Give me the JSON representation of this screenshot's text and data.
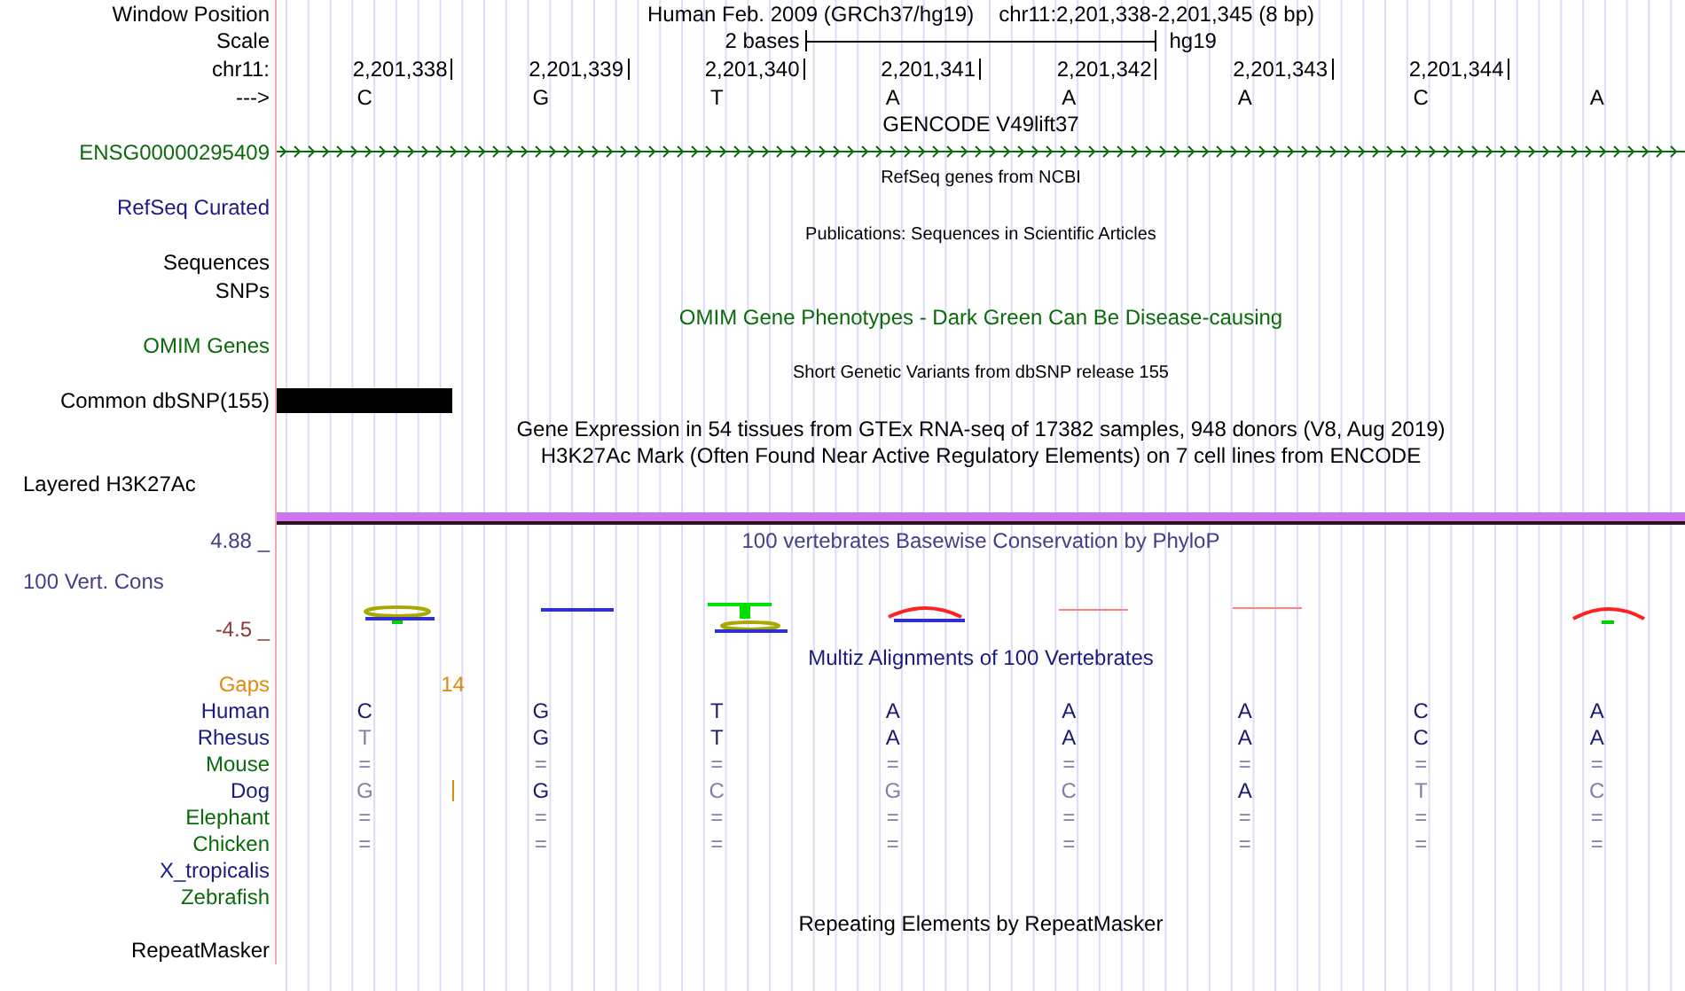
{
  "header": {
    "label": "Window Position",
    "assembly": "Human Feb. 2009 (GRCh37/hg19)",
    "position": "chr11:2,201,338-2,201,345 (8 bp)"
  },
  "scale": {
    "label": "Scale",
    "span": "2 bases",
    "database": "hg19"
  },
  "ruler": {
    "label": "chr11:",
    "positions": [
      "2,201,338",
      "2,201,339",
      "2,201,340",
      "2,201,341",
      "2,201,342",
      "2,201,343",
      "2,201,344"
    ]
  },
  "bases": {
    "label": "--->",
    "values": [
      "C",
      "G",
      "T",
      "A",
      "A",
      "A",
      "C",
      "A"
    ]
  },
  "tracks": [
    {
      "kind": "title",
      "title": "GENCODE V49lift37"
    },
    {
      "kind": "gene",
      "label": "ENSG00000295409",
      "color": "#0b6b0b"
    },
    {
      "kind": "small-title",
      "title": "RefSeq genes from NCBI"
    },
    {
      "kind": "label",
      "label": "RefSeq Curated",
      "color": "#1a1a80"
    },
    {
      "kind": "small-title",
      "title": "Publications: Sequences in Scientific Articles"
    },
    {
      "kind": "label",
      "label": "Sequences"
    },
    {
      "kind": "label",
      "label": "SNPs"
    },
    {
      "kind": "title",
      "title": "OMIM Gene Phenotypes - Dark Green Can Be Disease-causing",
      "color": "#0b6b0b"
    },
    {
      "kind": "label",
      "label": "OMIM Genes",
      "color": "#0b6b0b"
    },
    {
      "kind": "small-title",
      "title": "Short Genetic Variants from dbSNP release 155"
    },
    {
      "kind": "bar",
      "label": "Common dbSNP(155)"
    },
    {
      "kind": "title",
      "title": "Gene Expression in 54 tissues from GTEx RNA-seq of 17382 samples, 948 donors (V8, Aug 2019)"
    },
    {
      "kind": "title",
      "title": "H3K27Ac Mark (Often Found Near Active Regulatory Elements) on 7 cell lines from ENCODE"
    },
    {
      "kind": "left-label",
      "label": "Layered H3K27Ac"
    },
    {
      "kind": "divider"
    },
    {
      "kind": "wiggle",
      "max": "4.88 _",
      "title": "100 vertebrates Basewise Conservation by PhyloP",
      "label": "100 Vert. Cons",
      "min": "-4.5 _"
    },
    {
      "kind": "title",
      "title": "Multiz Alignments of 100 Vertebrates",
      "color": "#1a1a80"
    },
    {
      "kind": "gaps",
      "label": "Gaps",
      "count": "14"
    },
    {
      "kind": "species",
      "label": "Human",
      "color": "#1a1a80",
      "insertion": false,
      "bases": [
        {
          "text": "C",
          "match": true
        },
        {
          "text": "G",
          "match": true
        },
        {
          "text": "T",
          "match": true
        },
        {
          "text": "A",
          "match": true
        },
        {
          "text": "A",
          "match": true
        },
        {
          "text": "A",
          "match": true
        },
        {
          "text": "C",
          "match": true
        },
        {
          "text": "A",
          "match": true
        }
      ]
    },
    {
      "kind": "species",
      "label": "Rhesus",
      "color": "#1a1a80",
      "insertion": false,
      "bases": [
        {
          "text": "T",
          "match": false
        },
        {
          "text": "G",
          "match": true
        },
        {
          "text": "T",
          "match": true
        },
        {
          "text": "A",
          "match": true
        },
        {
          "text": "A",
          "match": true
        },
        {
          "text": "A",
          "match": true
        },
        {
          "text": "C",
          "match": true
        },
        {
          "text": "A",
          "match": true
        }
      ]
    },
    {
      "kind": "species",
      "label": "Mouse",
      "color": "#0b6b0b",
      "insertion": false,
      "bases": [
        {
          "text": "=",
          "match": false
        },
        {
          "text": "=",
          "match": false
        },
        {
          "text": "=",
          "match": false
        },
        {
          "text": "=",
          "match": false
        },
        {
          "text": "=",
          "match": false
        },
        {
          "text": "=",
          "match": false
        },
        {
          "text": "=",
          "match": false
        },
        {
          "text": "=",
          "match": false
        }
      ]
    },
    {
      "kind": "species",
      "label": "Dog",
      "color": "#1a1a80",
      "insertion": true,
      "bases": [
        {
          "text": "G",
          "match": false
        },
        {
          "text": "G",
          "match": true
        },
        {
          "text": "C",
          "match": false
        },
        {
          "text": "G",
          "match": false
        },
        {
          "text": "C",
          "match": false
        },
        {
          "text": "A",
          "match": true
        },
        {
          "text": "T",
          "match": false
        },
        {
          "text": "C",
          "match": false
        }
      ]
    },
    {
      "kind": "species",
      "label": "Elephant",
      "color": "#0b6b0b",
      "insertion": false,
      "bases": [
        {
          "text": "=",
          "match": false
        },
        {
          "text": "=",
          "match": false
        },
        {
          "text": "=",
          "match": false
        },
        {
          "text": "=",
          "match": false
        },
        {
          "text": "=",
          "match": false
        },
        {
          "text": "=",
          "match": false
        },
        {
          "text": "=",
          "match": false
        },
        {
          "text": "=",
          "match": false
        }
      ]
    },
    {
      "kind": "species",
      "label": "Chicken",
      "color": "#0b6b0b",
      "insertion": false,
      "bases": [
        {
          "text": "=",
          "match": false
        },
        {
          "text": "=",
          "match": false
        },
        {
          "text": "=",
          "match": false
        },
        {
          "text": "=",
          "match": false
        },
        {
          "text": "=",
          "match": false
        },
        {
          "text": "=",
          "match": false
        },
        {
          "text": "=",
          "match": false
        },
        {
          "text": "=",
          "match": false
        }
      ]
    },
    {
      "kind": "species",
      "label": "X_tropicalis",
      "color": "#1a1a80",
      "insertion": false
    },
    {
      "kind": "species",
      "label": "Zebrafish",
      "color": "#0b6b0b",
      "insertion": false
    },
    {
      "kind": "title",
      "title": "Repeating Elements by RepeatMasker"
    },
    {
      "kind": "label",
      "label": "RepeatMasker"
    }
  ]
}
